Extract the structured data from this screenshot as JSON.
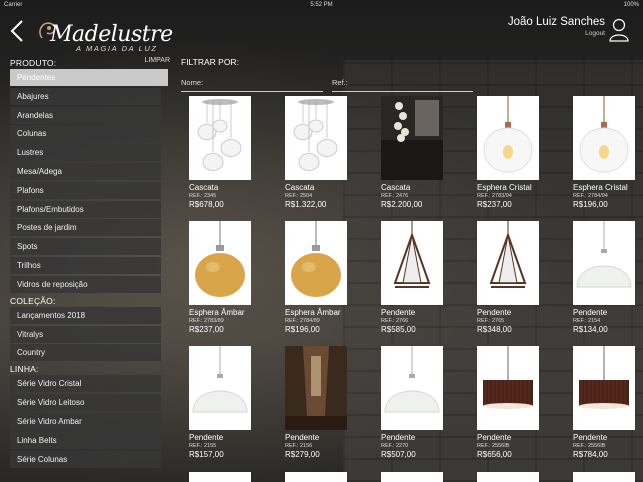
{
  "statusbar": {
    "carrier": "Carrier",
    "time": "5:52 PM",
    "battery": "100%"
  },
  "header": {
    "brand": "Madelustre",
    "tagline": "A MAGIA DA LUZ",
    "user_name": "João Luiz Sanches",
    "logout": "Logout"
  },
  "sidebar": {
    "produto_title": "PRODUTO:",
    "limpar": "LIMPAR",
    "produto_items": [
      "Pendentes",
      "Abajures",
      "Arandelas",
      "Colunas",
      "Lustres",
      "Mesa/Adega",
      "Plafons",
      "Plafons/Embutidos",
      "Postes de jardim",
      "Spots",
      "Trilhos",
      "Vidros de reposição"
    ],
    "colecao_title": "COLEÇÃO:",
    "colecao_items": [
      "Lançamentos 2018",
      "Vitralys",
      "Country"
    ],
    "linha_title": "LINHA:",
    "linha_items": [
      "Série Vidro Cristal",
      "Série Vidro Leitoso",
      "Série Vidro Ambar",
      "Linha Belts",
      "Série Colunas"
    ]
  },
  "filter": {
    "title": "FILTRAR POR:",
    "nome_label": "Nome:",
    "ref_label": "Ref.:"
  },
  "products": [
    {
      "name": "Cascata",
      "ref": "REF.: 2345",
      "price": "R$678,00",
      "kind": "cluster"
    },
    {
      "name": "Cascata",
      "ref": "REF.: 2504",
      "price": "R$1.322,00",
      "kind": "cluster"
    },
    {
      "name": "Cascata",
      "ref": "REF.: 2476",
      "price": "R$2.200,00",
      "kind": "photo"
    },
    {
      "name": "Esphera Cristal",
      "ref": "REF.: 2783/94",
      "price": "R$237,00",
      "kind": "clear"
    },
    {
      "name": "Esphera Cristal",
      "ref": "REF.: 2784/94",
      "price": "R$196,00",
      "kind": "clear"
    },
    {
      "name": "Esphera Âmbar",
      "ref": "REF.: 2783/89",
      "price": "R$237,00",
      "kind": "amber"
    },
    {
      "name": "Esphera Âmbar",
      "ref": "REF.: 2784/89",
      "price": "R$196,00",
      "kind": "amber"
    },
    {
      "name": "Pendente",
      "ref": "REF.: 2766",
      "price": "R$585,00",
      "kind": "lantern"
    },
    {
      "name": "Pendente",
      "ref": "REF.: 2765",
      "price": "R$348,00",
      "kind": "lantern"
    },
    {
      "name": "Pendente",
      "ref": "REF.: 2154",
      "price": "R$134,00",
      "kind": "dome"
    },
    {
      "name": "Pendente",
      "ref": "REF.: 2155",
      "price": "R$157,00",
      "kind": "dome"
    },
    {
      "name": "Pendente",
      "ref": "REF.: 2156",
      "price": "R$279,00",
      "kind": "photo2"
    },
    {
      "name": "Pendente",
      "ref": "REF.: 2270",
      "price": "R$507,00",
      "kind": "dome"
    },
    {
      "name": "Pendente",
      "ref": "REF.: 2556IB",
      "price": "R$656,00",
      "kind": "drum"
    },
    {
      "name": "Pendente",
      "ref": "REF.: 2556IB",
      "price": "R$784,00",
      "kind": "drum"
    }
  ]
}
